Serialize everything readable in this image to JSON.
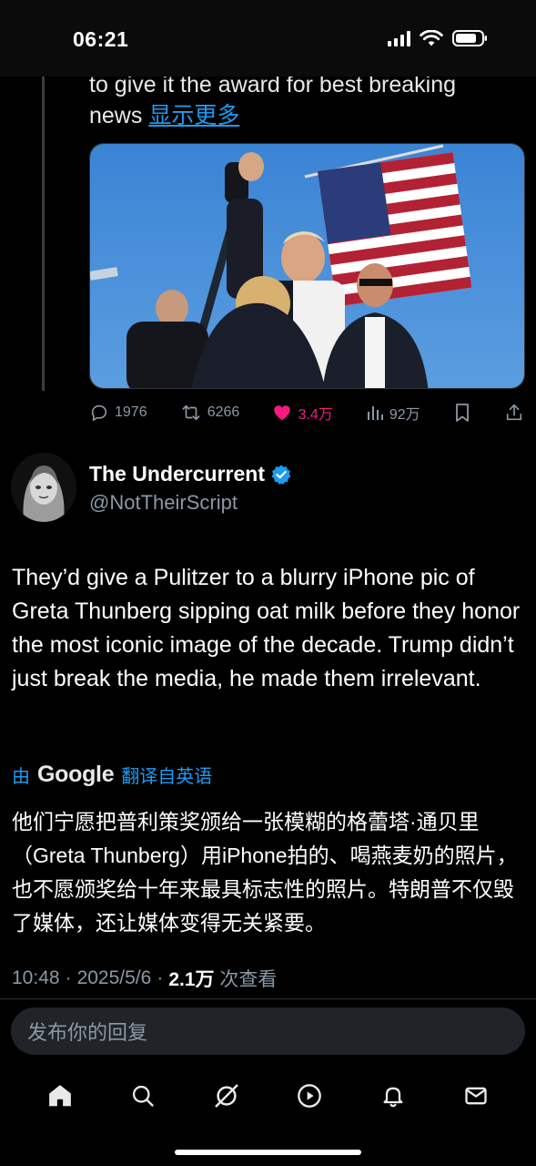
{
  "status_bar": {
    "time": "06:21"
  },
  "quoted_tweet": {
    "text_line": "to give it the award for best breaking news",
    "show_more": "显示更多",
    "media_icon": "photo-rally-flag",
    "stats": {
      "replies": "1976",
      "retweets": "6266",
      "likes": "3.4万",
      "views": "92万"
    }
  },
  "author": {
    "name": "The Undercurrent",
    "handle": "@NotTheirScript",
    "verified_icon": "verified-badge-icon"
  },
  "tweet": {
    "text": "They’d give a Pulitzer to a blurry iPhone pic of Greta Thunberg sipping oat milk before they honor the most iconic image of the decade. Trump didn’t just break the media, he made them irrelevant."
  },
  "translation": {
    "prefix": "由",
    "provider": "Google",
    "suffix": "翻译自英语",
    "text": "他们宁愿把普利策奖颁给一张模糊的格蕾塔·通贝里（Greta Thunberg）用iPhone拍的、喝燕麦奶的照片，也不愿颁奖给十年来最具标志性的照片。特朗普不仅毁了媒体，还让媒体变得无关紧要。"
  },
  "meta": {
    "time": "10:48",
    "date": "2025/5/6",
    "views_count": "2.1万",
    "views_label": "次查看"
  },
  "reply": {
    "placeholder": "发布你的回复"
  },
  "nav": [
    "home-icon",
    "search-icon",
    "grok-icon",
    "video-icon",
    "notifications-icon",
    "messages-icon"
  ],
  "colors": {
    "accent": "#1d9bf0",
    "like": "#f91880",
    "muted": "#8b98a5",
    "background": "#000000"
  }
}
